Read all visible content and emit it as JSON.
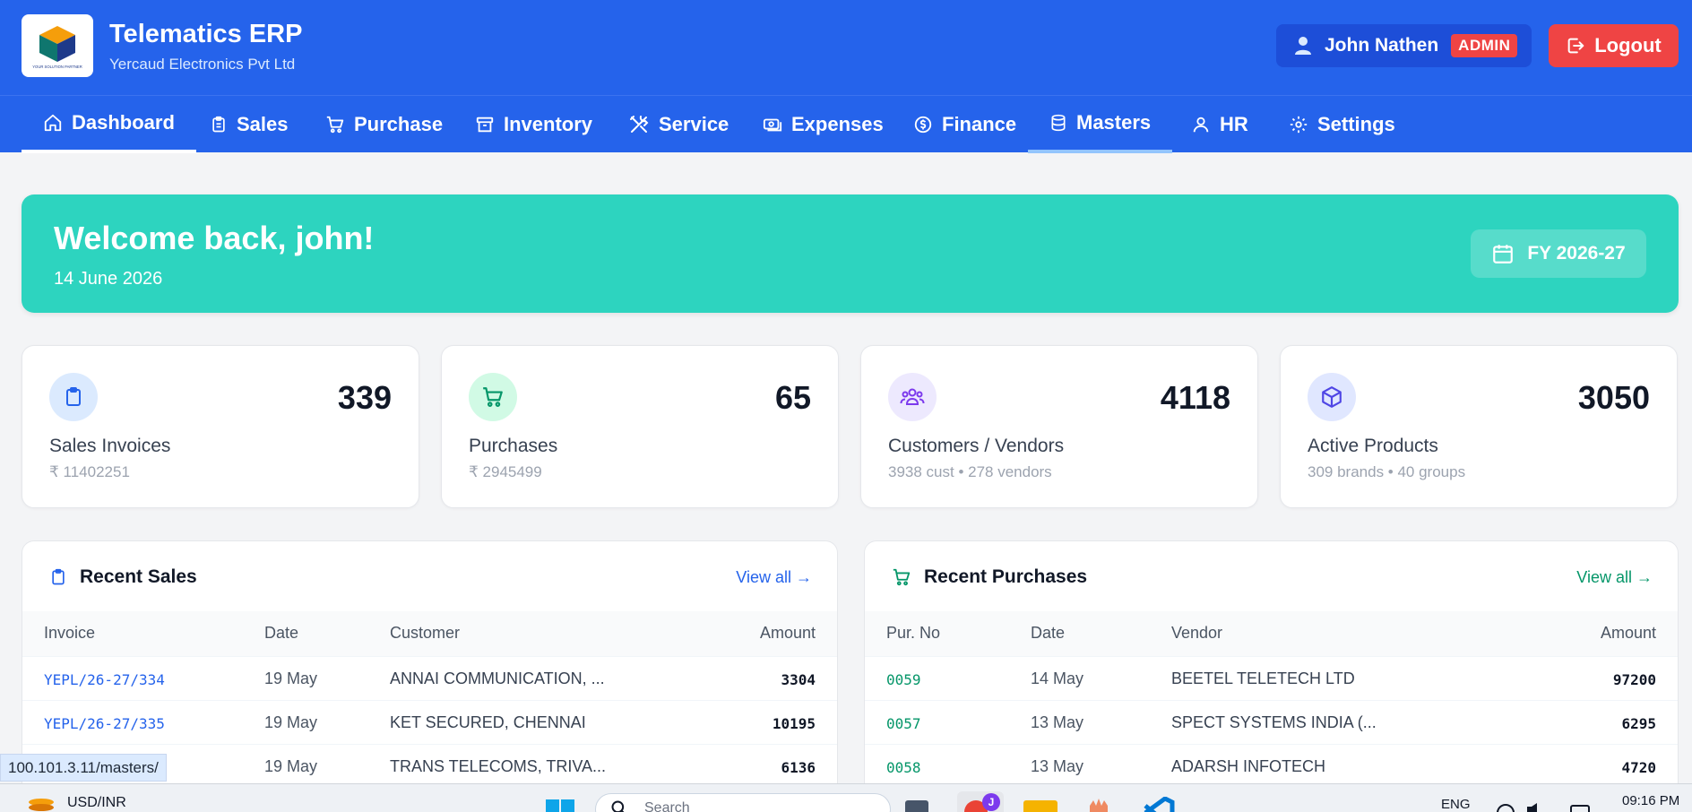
{
  "header": {
    "brand_title": "Telematics ERP",
    "brand_sub": "Yercaud Electronics Pvt Ltd",
    "logo_caption": "YOUR SOLUTION PARTNER",
    "user_name": "John Nathen",
    "role_badge": "ADMIN",
    "logout_label": "Logout"
  },
  "nav": {
    "items": [
      {
        "label": "Dashboard",
        "icon": "home-icon"
      },
      {
        "label": "Sales",
        "icon": "clipboard-icon"
      },
      {
        "label": "Purchase",
        "icon": "cart-icon"
      },
      {
        "label": "Inventory",
        "icon": "archive-icon"
      },
      {
        "label": "Service",
        "icon": "tools-icon"
      },
      {
        "label": "Expenses",
        "icon": "cash-icon"
      },
      {
        "label": "Finance",
        "icon": "currency-icon"
      },
      {
        "label": "Masters",
        "icon": "database-icon"
      },
      {
        "label": "HR",
        "icon": "users-icon"
      },
      {
        "label": "Settings",
        "icon": "gear-icon"
      }
    ]
  },
  "welcome": {
    "title": "Welcome back, john!",
    "date": "14 June 2026",
    "fy_label": "FY 2026-27"
  },
  "stats": [
    {
      "value": "339",
      "label": "Sales Invoices",
      "sub": "₹ 11402251",
      "icon": "clipboard-icon",
      "color": "#2563eb",
      "bg": "#dbeafe"
    },
    {
      "value": "65",
      "label": "Purchases",
      "sub": "₹ 2945499",
      "icon": "cart-icon",
      "color": "#059669",
      "bg": "#d1fae5"
    },
    {
      "value": "4118",
      "label": "Customers / Vendors",
      "sub": "3938 cust • 278 vendors",
      "icon": "users-icon",
      "color": "#7c3aed",
      "bg": "#ede9fe"
    },
    {
      "value": "3050",
      "label": "Active Products",
      "sub": "309 brands • 40 groups",
      "icon": "cube-icon",
      "color": "#4f46e5",
      "bg": "#e0e7ff"
    }
  ],
  "recent_sales": {
    "title": "Recent Sales",
    "view_all": "View all →",
    "accent": "#2563eb",
    "columns": [
      "Invoice",
      "Date",
      "Customer",
      "Amount"
    ],
    "rows": [
      {
        "invoice": "YEPL/26-27/334",
        "date": "19 May",
        "customer": "ANNAI COMMUNICATION, ...",
        "amount": "3304"
      },
      {
        "invoice": "YEPL/26-27/335",
        "date": "19 May",
        "customer": "KET SECURED, CHENNAI",
        "amount": "10195"
      },
      {
        "invoice": "",
        "date": "19 May",
        "customer": "TRANS TELECOMS, TRIVA...",
        "amount": "6136"
      }
    ]
  },
  "recent_purchases": {
    "title": "Recent Purchases",
    "view_all": "View all →",
    "accent": "#059669",
    "columns": [
      "Pur. No",
      "Date",
      "Vendor",
      "Amount"
    ],
    "rows": [
      {
        "no": "0059",
        "date": "14 May",
        "vendor": "BEETEL TELETECH LTD",
        "amount": "97200"
      },
      {
        "no": "0057",
        "date": "13 May",
        "vendor": "SPECT SYSTEMS INDIA (...",
        "amount": "6295"
      },
      {
        "no": "0058",
        "date": "13 May",
        "vendor": "ADARSH INFOTECH",
        "amount": "4720"
      }
    ]
  },
  "status_url": "100.101.3.11/masters/",
  "taskbar": {
    "currency": "USD/INR",
    "search_placeholder": "Search",
    "lang": "ENG",
    "time": "09:16 PM",
    "profile_initial": "J"
  }
}
